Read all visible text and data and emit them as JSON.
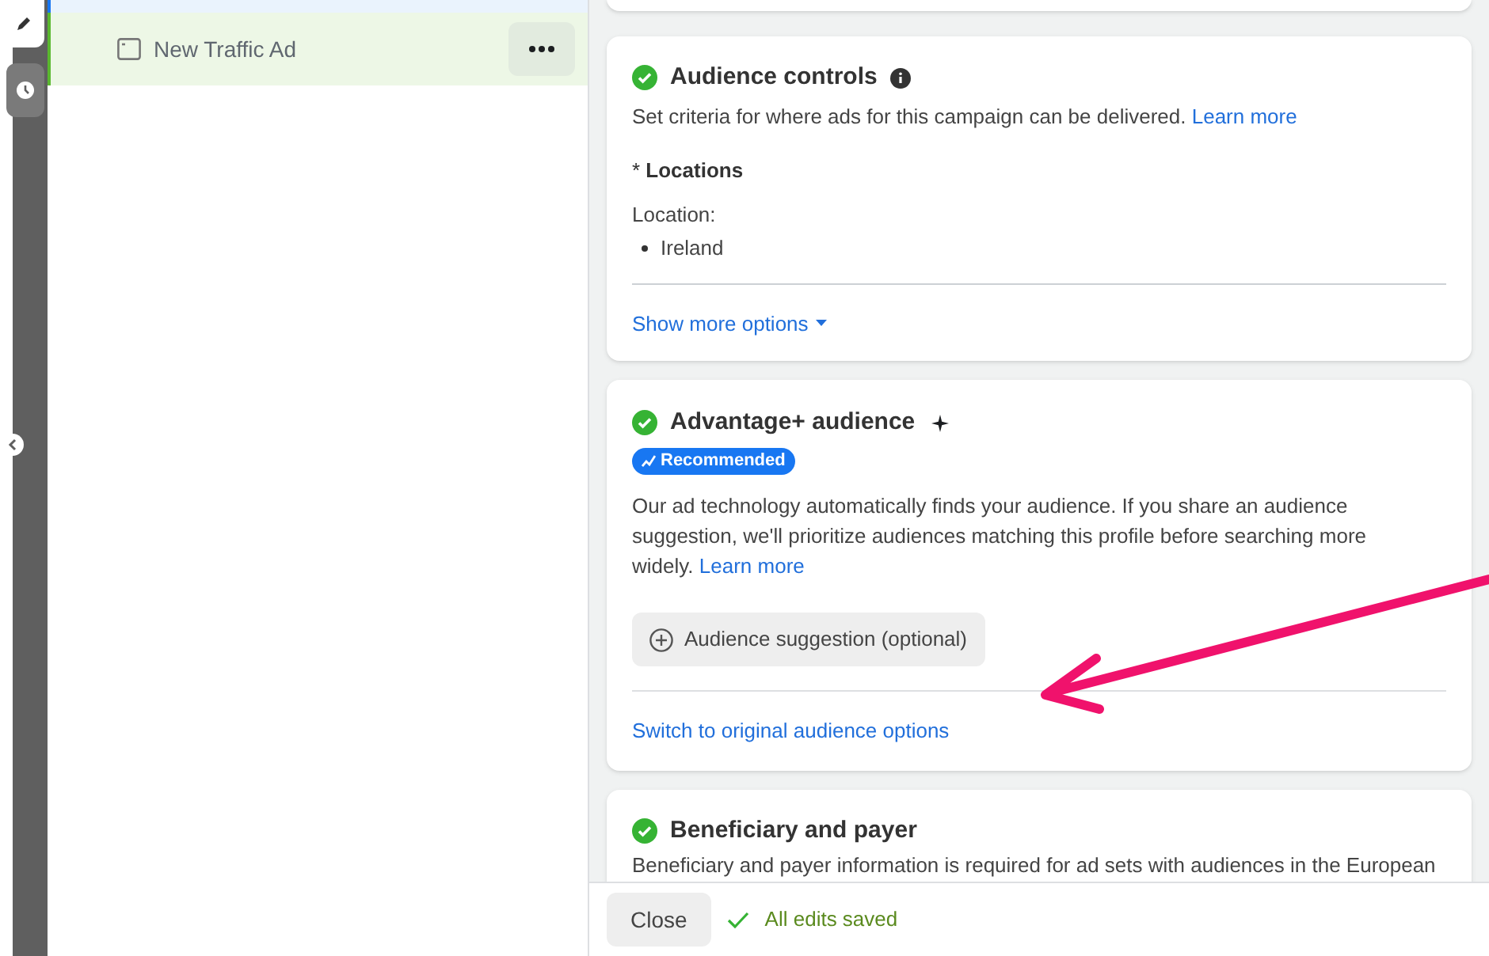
{
  "sidebar": {
    "items": [
      {
        "label": "New Traffic Ad",
        "selected": true
      }
    ]
  },
  "audience_controls": {
    "title": "Audience controls",
    "complete": true,
    "description": "Set criteria for where ads for this campaign can be delivered.",
    "link": "Learn more",
    "field_label": "* **Locations**",
    "location_label": "Location:",
    "locations": [
      "Ireland"
    ],
    "more_link": "Show more options"
  },
  "advantage_audience": {
    "title": "Advantage+ audience",
    "complete": true,
    "badge": "Recommended",
    "description": "Our ad technology automatically finds your audience. If you share an audience suggestion, we'll prioritize audiences matching this profile before searching more widely.",
    "link": "Learn more",
    "suggestion_button": "Audience suggestion (optional)",
    "switch_link": "Switch to original audience options"
  },
  "beneficiary": {
    "title": "Beneficiary and payer",
    "complete": true,
    "description": "Beneficiary and payer information is required for ad sets with audiences in the European"
  },
  "footer": {
    "close_button": "Close",
    "status": "All edits saved"
  }
}
